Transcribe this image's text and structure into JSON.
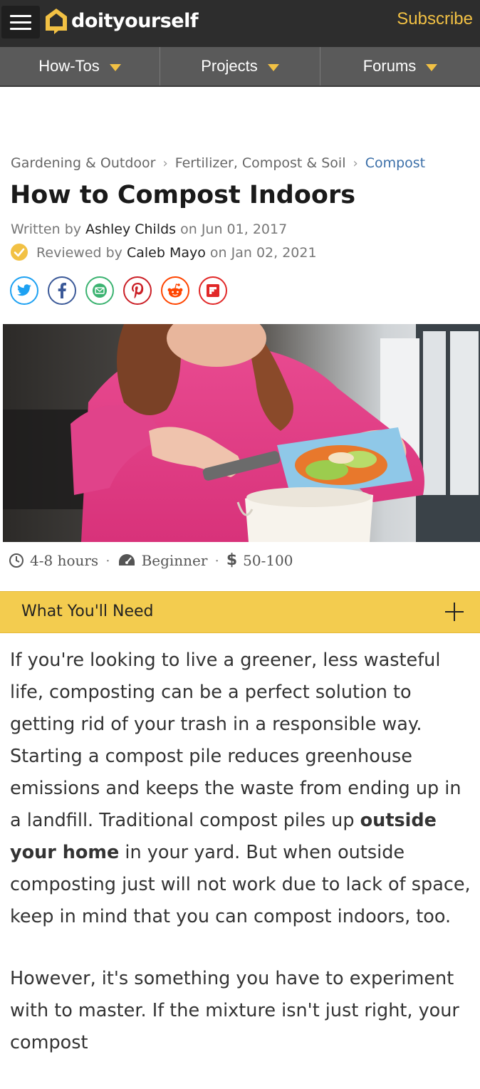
{
  "header": {
    "brand": "doityourself",
    "subscribe_label": "Subscribe"
  },
  "nav": {
    "items": [
      {
        "label": "How-Tos"
      },
      {
        "label": "Projects"
      },
      {
        "label": "Forums"
      }
    ]
  },
  "breadcrumb": {
    "items": [
      "Gardening & Outdoor",
      "Fertilizer, Compost & Soil",
      "Compost"
    ]
  },
  "article": {
    "title": "How to Compost Indoors",
    "written_prefix": "Written by",
    "author": "Ashley Childs",
    "written_on": "on Jun 01, 2017",
    "reviewed_prefix": "Reviewed by",
    "reviewer": "Caleb Mayo",
    "reviewed_on": "on Jan 02, 2021",
    "meta": {
      "time": "4-8 hours",
      "difficulty": "Beginner",
      "cost": "50-100"
    },
    "needs_label": "What You'll Need",
    "para1_a": "If you're looking to live a greener, less wasteful life, composting can be a perfect solution to getting rid of your trash in a responsible way. Starting a compost pile reduces greenhouse emissions and keeps the waste from ending up in a landfill. Traditional compost piles up ",
    "para1_link": "outside your home",
    "para1_b": " in your yard. But when outside composting just will not work due to lack of space, keep in mind that you can compost indoors, too.",
    "para2": "However, it's something you have to experiment with to master. If the mixture isn't just right, your compost"
  },
  "social": [
    "twitter-icon",
    "facebook-icon",
    "email-icon",
    "pinterest-icon",
    "reddit-icon",
    "flipboard-icon"
  ],
  "colors": {
    "brand_yellow": "#f2c144",
    "header_dark": "#2d2d2d",
    "nav_gray": "#5a5a5a",
    "link_blue": "#3b6fa8"
  }
}
